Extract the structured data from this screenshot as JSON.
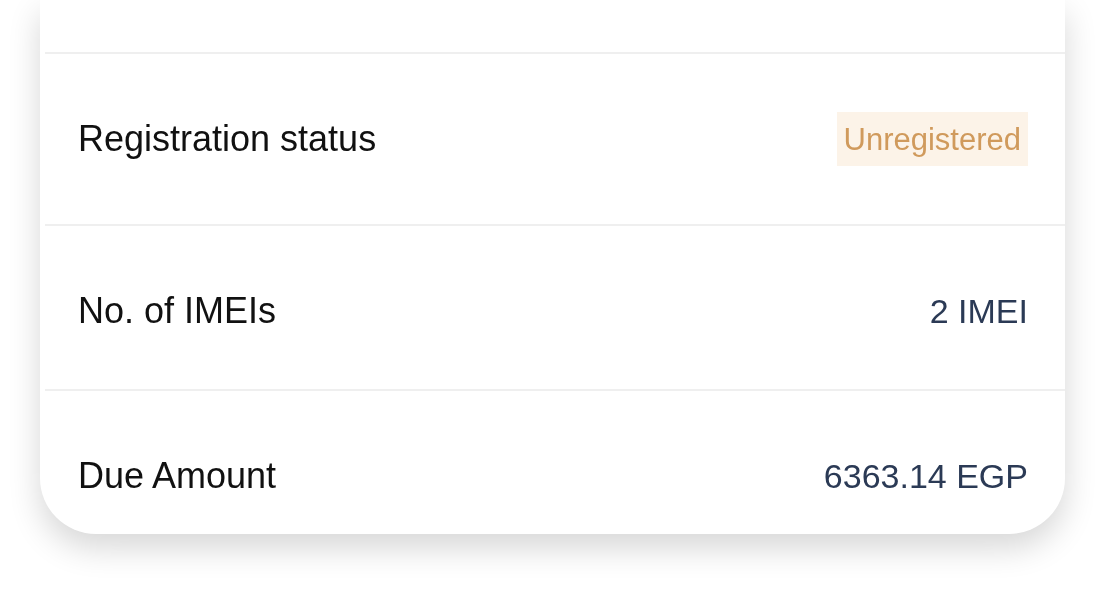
{
  "details": {
    "rows": [
      {
        "label": "Registration status",
        "value": "Unregistered",
        "kind": "badge"
      },
      {
        "label": "No. of IMEIs",
        "value": "2 IMEI",
        "kind": "text"
      },
      {
        "label": "Due Amount",
        "value": "6363.14 EGP",
        "kind": "text"
      }
    ]
  }
}
